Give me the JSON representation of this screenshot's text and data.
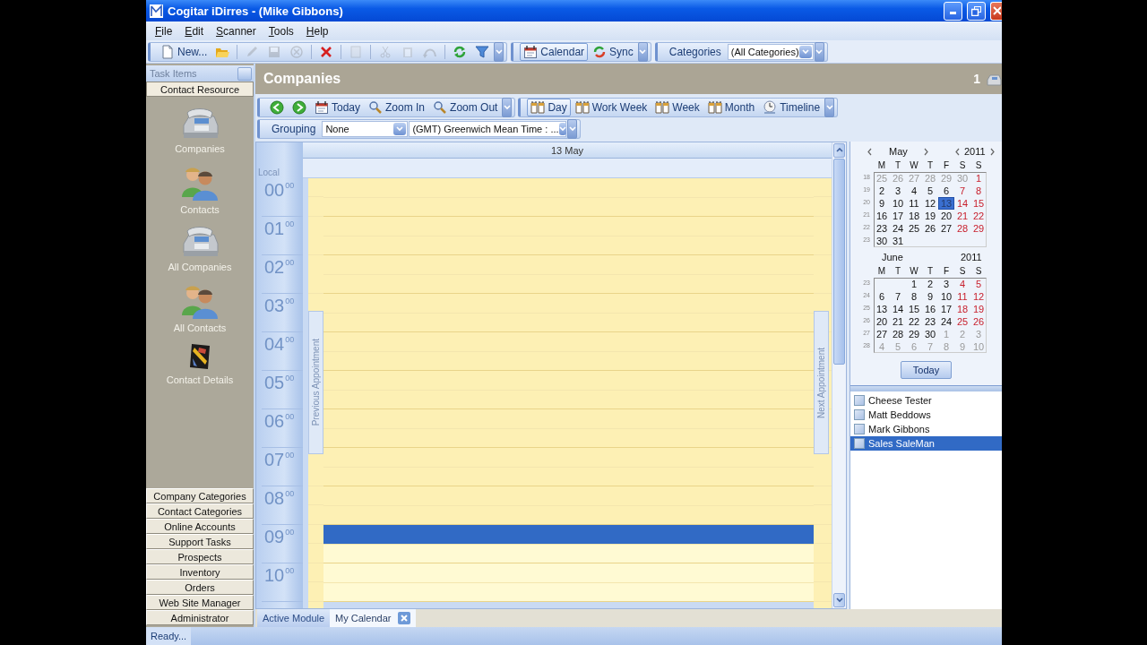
{
  "window": {
    "title": "Cogitar iDirres - (Mike Gibbons)"
  },
  "menu": [
    {
      "label": "File"
    },
    {
      "label": "Edit"
    },
    {
      "label": "Scanner"
    },
    {
      "label": "Tools"
    },
    {
      "label": "Help"
    }
  ],
  "toolbar": {
    "items": [
      {
        "label": "New...",
        "disabled": false
      },
      {
        "disabled": false
      },
      {
        "disabled": true
      },
      {
        "disabled": true
      },
      {
        "disabled": true
      },
      {
        "disabled": false
      },
      {
        "disabled": true
      },
      {
        "disabled": true
      },
      {
        "disabled": true
      },
      {
        "disabled": true
      },
      {
        "disabled": false
      },
      {
        "disabled": false
      }
    ],
    "views": [
      {
        "label": "Calendar",
        "selected": true
      },
      {
        "label": "Sync",
        "selected": false
      }
    ],
    "categories": {
      "label": "Categories",
      "value": "(All Categories)"
    }
  },
  "sidebar": {
    "title": "Task Items",
    "section": "Contact Resource",
    "items": [
      {
        "label": "Companies"
      },
      {
        "label": "Contacts"
      },
      {
        "label": "All Companies"
      },
      {
        "label": "All Contacts"
      },
      {
        "label": "Contact Details"
      }
    ],
    "nav": [
      {
        "label": "Company Categories"
      },
      {
        "label": "Contact Categories"
      },
      {
        "label": "Online Accounts"
      },
      {
        "label": "Support Tasks"
      },
      {
        "label": "Prospects"
      },
      {
        "label": "Inventory"
      },
      {
        "label": "Orders"
      },
      {
        "label": "Web Site Manager"
      },
      {
        "label": "Administrator"
      }
    ]
  },
  "module": {
    "title": "Companies",
    "count": "1"
  },
  "calendar_toolbar": {
    "nav": [
      {
        "label": "Today"
      },
      {
        "label": "Zoom In"
      },
      {
        "label": "Zoom Out"
      }
    ],
    "views": [
      {
        "label": "Day",
        "selected": true
      },
      {
        "label": "Work Week",
        "selected": false
      },
      {
        "label": "Week",
        "selected": false
      },
      {
        "label": "Month",
        "selected": false
      },
      {
        "label": "Timeline",
        "selected": false
      }
    ]
  },
  "filters": {
    "grouping_label": "Grouping",
    "grouping": "None",
    "timezone": "(GMT) Greenwich Mean Time : ..."
  },
  "day_view": {
    "date": "13 May",
    "zone": "Local",
    "previous": "Previous Appointment",
    "next": "Next Appointment",
    "hours": [
      {
        "label": "00$^{00}$",
        "working": false,
        "slots": [
          {
            "selected": false
          },
          {
            "selected": false
          }
        ]
      },
      {
        "label": "01$^{00}$",
        "working": false,
        "slots": [
          {
            "selected": false
          },
          {
            "selected": false
          }
        ]
      },
      {
        "label": "02$^{00}$",
        "working": false,
        "slots": [
          {
            "selected": false
          },
          {
            "selected": false
          }
        ]
      },
      {
        "label": "03$^{00}$",
        "working": false,
        "slots": [
          {
            "selected": false
          },
          {
            "selected": false
          }
        ]
      },
      {
        "label": "04$^{00}$",
        "working": false,
        "slots": [
          {
            "selected": false
          },
          {
            "selected": false
          }
        ]
      },
      {
        "label": "05$^{00}$",
        "working": false,
        "slots": [
          {
            "selected": false
          },
          {
            "selected": false
          }
        ]
      },
      {
        "label": "06$^{00}$",
        "working": false,
        "slots": [
          {
            "selected": false
          },
          {
            "selected": false
          }
        ]
      },
      {
        "label": "07$^{00}$",
        "working": false,
        "slots": [
          {
            "selected": false
          },
          {
            "selected": false
          }
        ]
      },
      {
        "label": "08$^{00}$",
        "working": false,
        "slots": [
          {
            "selected": false
          },
          {
            "selected": false
          }
        ]
      },
      {
        "label": "09$^{00}$",
        "working": true,
        "slots": [
          {
            "selected": true
          },
          {
            "selected": false
          }
        ]
      },
      {
        "label": "10$^{00}$",
        "working": true,
        "slots": [
          {
            "selected": false
          },
          {
            "selected": false
          }
        ]
      }
    ]
  },
  "mini_calendar": {
    "today": "Today",
    "months": [
      {
        "month": "May",
        "year": "2011",
        "navigation": true,
        "weekdays": [
          "M",
          "T",
          "W",
          "T",
          "F",
          "S",
          "S"
        ],
        "weeks": [
          {
            "number": "18",
            "days": [
              {
                "kind": "day",
                "day": "25",
                "other_month": true,
                "selected": false
              },
              {
                "kind": "day",
                "day": "26",
                "other_month": true,
                "selected": false
              },
              {
                "kind": "day",
                "day": "27",
                "other_month": true,
                "selected": false
              },
              {
                "kind": "day",
                "day": "28",
                "other_month": true,
                "selected": false
              },
              {
                "kind": "day",
                "day": "29",
                "other_month": true,
                "selected": false
              },
              {
                "kind": "day",
                "day": "30",
                "other_month": true,
                "selected": false
              },
              {
                "kind": "day",
                "day": "1",
                "other_month": false,
                "selected": false
              }
            ]
          },
          {
            "number": "19",
            "days": [
              {
                "kind": "day",
                "day": "2",
                "other_month": false,
                "selected": false
              },
              {
                "kind": "day",
                "day": "3",
                "other_month": false,
                "selected": false
              },
              {
                "kind": "day",
                "day": "4",
                "other_month": false,
                "selected": false
              },
              {
                "kind": "day",
                "day": "5",
                "other_month": false,
                "selected": false
              },
              {
                "kind": "day",
                "day": "6",
                "other_month": false,
                "selected": false
              },
              {
                "kind": "day",
                "day": "7",
                "other_month": false,
                "selected": false
              },
              {
                "kind": "day",
                "day": "8",
                "other_month": false,
                "selected": false
              }
            ]
          },
          {
            "number": "20",
            "days": [
              {
                "kind": "day",
                "day": "9",
                "other_month": false,
                "selected": false
              },
              {
                "kind": "day",
                "day": "10",
                "other_month": false,
                "selected": false
              },
              {
                "kind": "day",
                "day": "11",
                "other_month": false,
                "selected": false
              },
              {
                "kind": "day",
                "day": "12",
                "other_month": false,
                "selected": false
              },
              {
                "kind": "day",
                "day": "13",
                "other_month": false,
                "selected": true
              },
              {
                "kind": "day",
                "day": "14",
                "other_month": false,
                "selected": false
              },
              {
                "kind": "day",
                "day": "15",
                "other_month": false,
                "selected": false
              }
            ]
          },
          {
            "number": "21",
            "days": [
              {
                "kind": "day",
                "day": "16",
                "other_month": false,
                "selected": false
              },
              {
                "kind": "day",
                "day": "17",
                "other_month": false,
                "selected": false
              },
              {
                "kind": "day",
                "day": "18",
                "other_month": false,
                "selected": false
              },
              {
                "kind": "day",
                "day": "19",
                "other_month": false,
                "selected": false
              },
              {
                "kind": "day",
                "day": "20",
                "other_month": false,
                "selected": false
              },
              {
                "kind": "day",
                "day": "21",
                "other_month": false,
                "selected": false
              },
              {
                "kind": "day",
                "day": "22",
                "other_month": false,
                "selected": false
              }
            ]
          },
          {
            "number": "22",
            "days": [
              {
                "kind": "day",
                "day": "23",
                "other_month": false,
                "selected": false
              },
              {
                "kind": "day",
                "day": "24",
                "other_month": false,
                "selected": false
              },
              {
                "kind": "day",
                "day": "25",
                "other_month": false,
                "selected": false
              },
              {
                "kind": "day",
                "day": "26",
                "other_month": false,
                "selected": false
              },
              {
                "kind": "day",
                "day": "27",
                "other_month": false,
                "selected": false
              },
              {
                "kind": "day",
                "day": "28",
                "other_month": false,
                "selected": false
              },
              {
                "kind": "day",
                "day": "29",
                "other_month": false,
                "selected": false
              }
            ]
          },
          {
            "number": "23",
            "days": [
              {
                "kind": "day",
                "day": "30",
                "other_month": false,
                "selected": false
              },
              {
                "kind": "day",
                "day": "31",
                "other_month": false,
                "selected": false
              }
            ]
          }
        ]
      },
      {
        "month": "June",
        "year": "2011",
        "navigation": false,
        "weekdays": [
          "M",
          "T",
          "W",
          "T",
          "F",
          "S",
          "S"
        ],
        "weeks": [
          {
            "number": "23",
            "days": [
              {
                "kind": "blank"
              },
              {
                "kind": "blank"
              },
              {
                "kind": "day",
                "day": "1",
                "other_month": false,
                "selected": false
              },
              {
                "kind": "day",
                "day": "2",
                "other_month": false,
                "selected": false
              },
              {
                "kind": "day",
                "day": "3",
                "other_month": false,
                "selected": false
              },
              {
                "kind": "day",
                "day": "4",
                "other_month": false,
                "selected": false
              },
              {
                "kind": "day",
                "day": "5",
                "other_month": false,
                "selected": false
              }
            ]
          },
          {
            "number": "24",
            "days": [
              {
                "kind": "day",
                "day": "6",
                "other_month": false,
                "selected": false
              },
              {
                "kind": "day",
                "day": "7",
                "other_month": false,
                "selected": false
              },
              {
                "kind": "day",
                "day": "8",
                "other_month": false,
                "selected": false
              },
              {
                "kind": "day",
                "day": "9",
                "other_month": false,
                "selected": false
              },
              {
                "kind": "day",
                "day": "10",
                "other_month": false,
                "selected": false
              },
              {
                "kind": "day",
                "day": "11",
                "other_month": false,
                "selected": false
              },
              {
                "kind": "day",
                "day": "12",
                "other_month": false,
                "selected": false
              }
            ]
          },
          {
            "number": "25",
            "days": [
              {
                "kind": "day",
                "day": "13",
                "other_month": false,
                "selected": false
              },
              {
                "kind": "day",
                "day": "14",
                "other_month": false,
                "selected": false
              },
              {
                "kind": "day",
                "day": "15",
                "other_month": false,
                "selected": false
              },
              {
                "kind": "day",
                "day": "16",
                "other_month": false,
                "selected": false
              },
              {
                "kind": "day",
                "day": "17",
                "other_month": false,
                "selected": false
              },
              {
                "kind": "day",
                "day": "18",
                "other_month": false,
                "selected": false
              },
              {
                "kind": "day",
                "day": "19",
                "other_month": false,
                "selected": false
              }
            ]
          },
          {
            "number": "26",
            "days": [
              {
                "kind": "day",
                "day": "20",
                "other_month": false,
                "selected": false
              },
              {
                "kind": "day",
                "day": "21",
                "other_month": false,
                "selected": false
              },
              {
                "kind": "day",
                "day": "22",
                "other_month": false,
                "selected": false
              },
              {
                "kind": "day",
                "day": "23",
                "other_month": false,
                "selected": false
              },
              {
                "kind": "day",
                "day": "24",
                "other_month": false,
                "selected": false
              },
              {
                "kind": "day",
                "day": "25",
                "other_month": false,
                "selected": false
              },
              {
                "kind": "day",
                "day": "26",
                "other_month": false,
                "selected": false
              }
            ]
          },
          {
            "number": "27",
            "days": [
              {
                "kind": "day",
                "day": "27",
                "other_month": false,
                "selected": false
              },
              {
                "kind": "day",
                "day": "28",
                "other_month": false,
                "selected": false
              },
              {
                "kind": "day",
                "day": "29",
                "other_month": false,
                "selected": false
              },
              {
                "kind": "day",
                "day": "30",
                "other_month": false,
                "selected": false
              },
              {
                "kind": "day",
                "day": "1",
                "other_month": true,
                "selected": false
              },
              {
                "kind": "day",
                "day": "2",
                "other_month": true,
                "selected": false
              },
              {
                "kind": "day",
                "day": "3",
                "other_month": true,
                "selected": false
              }
            ]
          },
          {
            "number": "28",
            "days": [
              {
                "kind": "day",
                "day": "4",
                "other_month": true,
                "selected": false
              },
              {
                "kind": "day",
                "day": "5",
                "other_month": true,
                "selected": false
              },
              {
                "kind": "day",
                "day": "6",
                "other_month": true,
                "selected": false
              },
              {
                "kind": "day",
                "day": "7",
                "other_month": true,
                "selected": false
              },
              {
                "kind": "day",
                "day": "8",
                "other_month": true,
                "selected": false
              },
              {
                "kind": "day",
                "day": "9",
                "other_month": true,
                "selected": false
              },
              {
                "kind": "day",
                "day": "10",
                "other_month": true,
                "selected": false
              }
            ]
          }
        ]
      }
    ]
  },
  "resources": [
    {
      "name": "Cheese Tester",
      "checked": false,
      "selected": false
    },
    {
      "name": "Matt Beddows",
      "checked": false,
      "selected": false
    },
    {
      "name": "Mark Gibbons",
      "checked": false,
      "selected": false
    },
    {
      "name": "Sales SaleMan",
      "checked": false,
      "selected": true
    }
  ],
  "tabs": [
    {
      "label": "Active Module",
      "selected": false,
      "closable": false
    },
    {
      "label": "My Calendar",
      "selected": true,
      "closable": true
    }
  ],
  "status": "Ready..."
}
